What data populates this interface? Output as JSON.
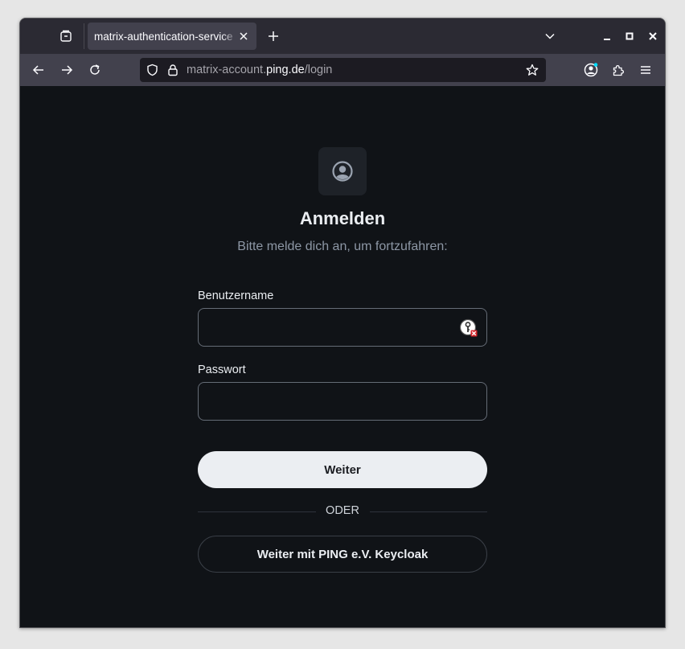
{
  "browser": {
    "tab": {
      "title": "matrix-authentication-service"
    },
    "url": {
      "prefix": "matrix-account.",
      "domain": "ping.de",
      "path": "/login"
    },
    "icons": {
      "tab_overview": "firefox-view-icon",
      "close_tab": "close-icon",
      "new_tab": "plus-icon",
      "tab_list": "chevron-down-icon",
      "minimize": "minimize-icon",
      "maximize": "maximize-icon",
      "close_window": "close-icon",
      "back": "arrow-left-icon",
      "forward": "arrow-right-icon",
      "reload": "reload-icon",
      "tracking_protection": "shield-icon",
      "lock": "lock-icon",
      "bookmark": "star-icon",
      "account": "account-icon",
      "extensions": "puzzle-icon",
      "menu": "hamburger-icon"
    }
  },
  "login": {
    "heading": "Anmelden",
    "subheading": "Bitte melde dich an, um fortzufahren:",
    "username_label": "Benutzername",
    "username_value": "",
    "password_label": "Passwort",
    "password_value": "",
    "submit_label": "Weiter",
    "divider_text": "ODER",
    "sso_label": "Weiter mit PING e.V. Keycloak"
  },
  "colors": {
    "page_background": "#101317",
    "primary_button": "#ebeef2",
    "text_muted": "#8d97a5",
    "browser_chrome": "#2b2a33",
    "navbar": "#42414d"
  }
}
